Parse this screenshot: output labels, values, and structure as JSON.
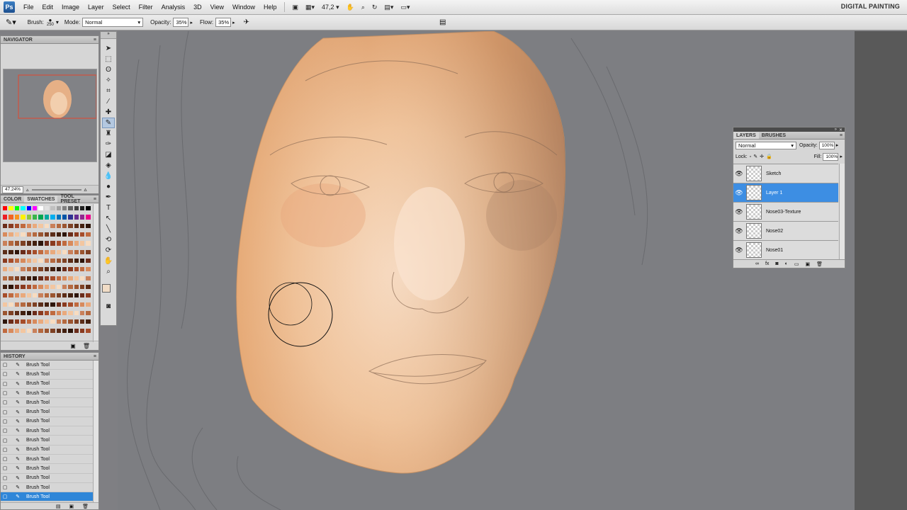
{
  "app": {
    "logo": "Ps",
    "workspace": "DIGITAL PAINTING"
  },
  "menu": [
    "File",
    "Edit",
    "Image",
    "Layer",
    "Select",
    "Filter",
    "Analysis",
    "3D",
    "View",
    "Window",
    "Help"
  ],
  "menubar_zoom": "47,2",
  "options": {
    "brush_label": "Brush:",
    "brush_size": "250",
    "mode_label": "Mode:",
    "mode_value": "Normal",
    "opacity_label": "Opacity:",
    "opacity_value": "35%",
    "flow_label": "Flow:",
    "flow_value": "35%"
  },
  "navigator": {
    "title": "NAVIGATOR",
    "zoom": "47.24%"
  },
  "color_panel": {
    "tabs": [
      "COLOR",
      "SWATCHES",
      "TOOL PRESET"
    ]
  },
  "history": {
    "title": "HISTORY",
    "items": [
      "Brush Tool",
      "Brush Tool",
      "Brush Tool",
      "Brush Tool",
      "Brush Tool",
      "Brush Tool",
      "Brush Tool",
      "Brush Tool",
      "Brush Tool",
      "Brush Tool",
      "Brush Tool",
      "Brush Tool",
      "Brush Tool",
      "Brush Tool",
      "Brush Tool"
    ],
    "selected_index": 14
  },
  "layers": {
    "tabs": [
      "LAYERS",
      "BRUSHES"
    ],
    "blend_mode": "Normal",
    "opacity_label": "Opacity:",
    "opacity_value": "100%",
    "lock_label": "Lock:",
    "fill_label": "Fill:",
    "fill_value": "100%",
    "items": [
      "Sketch",
      "Layer 1",
      "Nose03-Texture",
      "Nose02",
      "Nose01"
    ],
    "selected_index": 1
  },
  "colors": {
    "accent": "#3d8ee3",
    "canvas_bg": "#7d7e82",
    "skin": "#e9b88e"
  }
}
